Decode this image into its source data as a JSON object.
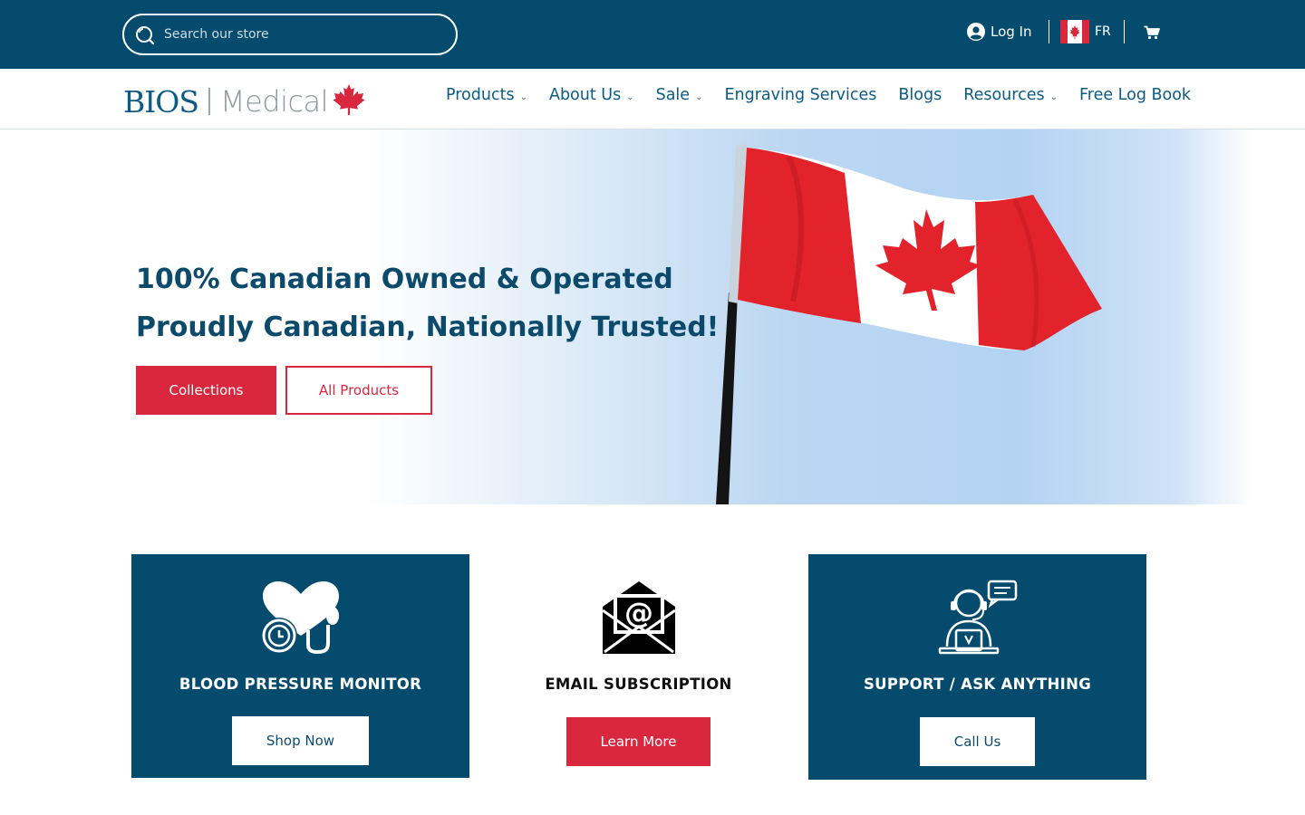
{
  "colors": {
    "topbar": "#054b6e",
    "brand_red": "#d9273e",
    "nav_text": "#0b5b84",
    "card_dark": "#054b6e"
  },
  "topbar": {
    "search_placeholder": "Search our store",
    "search_icon": "search-icon",
    "login_label": "Log In",
    "user_icon": "user-icon",
    "language_label": "FR",
    "flag_icon": "canada-flag-icon",
    "cart_icon": "cart-icon"
  },
  "header": {
    "logo_primary": "BIOS",
    "logo_secondary": "Medical",
    "logo_icon": "maple-leaf-icon",
    "nav": [
      {
        "label": "Products",
        "dropdown": true
      },
      {
        "label": "About Us",
        "dropdown": true
      },
      {
        "label": "Sale",
        "dropdown": true
      },
      {
        "label": "Engraving Services",
        "dropdown": false
      },
      {
        "label": "Blogs",
        "dropdown": false
      },
      {
        "label": "Resources",
        "dropdown": true
      },
      {
        "label": "Free Log Book",
        "dropdown": false
      }
    ]
  },
  "hero": {
    "title": "100% Canadian Owned & Operated",
    "subtitle": "Proudly Canadian, Nationally Trusted!",
    "primary_button": "Collections",
    "secondary_button": "All Products",
    "image": "canadian-flag-on-pole"
  },
  "cards": [
    {
      "title": "BLOOD PRESSURE MONITOR",
      "button": "Shop Now",
      "icon": "heart-stethoscope-icon"
    },
    {
      "title": "EMAIL SUBSCRIPTION",
      "button": "Learn More",
      "icon": "email-envelope-icon"
    },
    {
      "title": "SUPPORT / ASK ANYTHING",
      "button": "Call Us",
      "icon": "support-agent-icon"
    }
  ]
}
